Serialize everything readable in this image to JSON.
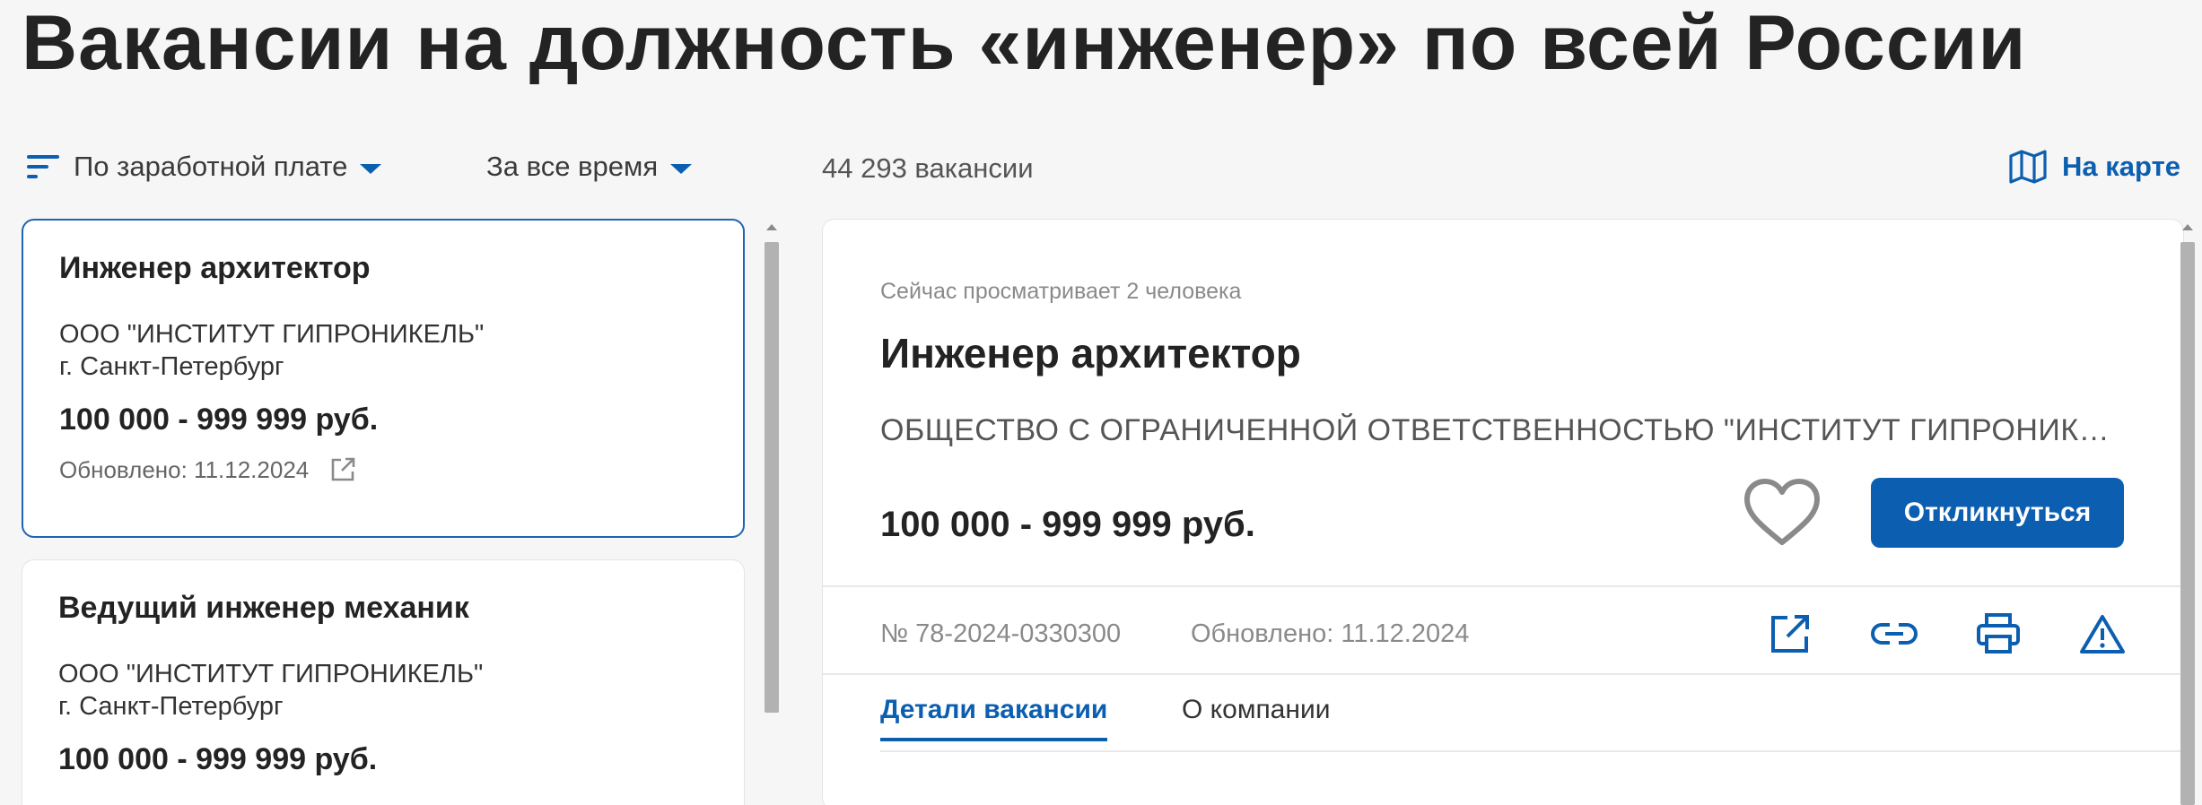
{
  "page": {
    "title": "Вакансии на должность «инженер» по всей России"
  },
  "filters": {
    "sort_label": "По заработной плате",
    "period_label": "За все время",
    "count_text": "44 293 вакансии",
    "map_label": "На карте"
  },
  "list": {
    "cards": [
      {
        "title": "Инженер архитектор",
        "company": "ООО \"ИНСТИТУТ ГИПРОНИКЕЛЬ\"",
        "city": "г. Санкт-Петербург",
        "salary": "100 000 - 999 999 руб.",
        "updated": "Обновлено: 11.12.2024"
      },
      {
        "title": "Ведущий инженер механик",
        "company": "ООО \"ИНСТИТУТ ГИПРОНИКЕЛЬ\"",
        "city": "г. Санкт-Петербург",
        "salary": "100 000 - 999 999 руб."
      }
    ]
  },
  "detail": {
    "viewers": "Сейчас просматривает 2 человека",
    "title": "Инженер архитектор",
    "company": "ОБЩЕСТВО С ОГРАНИЧЕННОЙ ОТВЕТСТВЕННОСТЬЮ \"ИНСТИТУТ ГИПРОНИКЕЛЬ\"",
    "salary": "100 000 - 999 999 руб.",
    "respond_label": "Откликнуться",
    "number": "№ 78-2024-0330300",
    "updated": "Обновлено: 11.12.2024",
    "tabs": [
      {
        "label": "Детали вакансии"
      },
      {
        "label": "О компании"
      }
    ],
    "actions": [
      "external-link-icon",
      "link-icon",
      "print-icon",
      "warning-icon"
    ]
  },
  "colors": {
    "accent": "#0c5fb0",
    "active_border": "#1e64b4",
    "background": "#f6f6f6"
  }
}
